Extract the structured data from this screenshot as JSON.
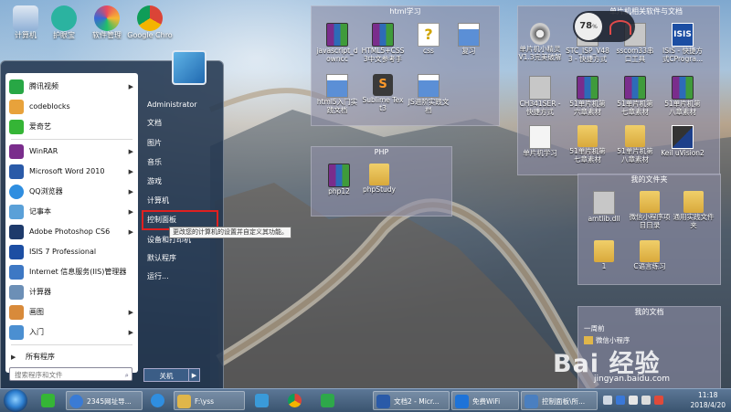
{
  "desktop_icons": [
    {
      "label": "计算机",
      "icon": "computer-icon"
    },
    {
      "label": "护眼宝",
      "icon": "eye-protect-icon"
    },
    {
      "label": "软件管理",
      "icon": "software-manager-icon"
    },
    {
      "label": "Google Chro",
      "icon": "chrome-icon"
    }
  ],
  "speed_widget": {
    "percent": "78",
    "unit": "%"
  },
  "panels": {
    "html": {
      "title": "html学习",
      "items": [
        {
          "label": "javascript_d owncc",
          "icon": "rar"
        },
        {
          "label": "HTML5+CSS 3中文参考手",
          "icon": "rar"
        },
        {
          "label": "css",
          "icon": "q"
        },
        {
          "label": "复习",
          "icon": "blue"
        },
        {
          "label": "html5入门实 践文档",
          "icon": "blue"
        },
        {
          "label": "Sublime Tex t3",
          "icon": "subl"
        },
        {
          "label": "JS进阶实践文 档",
          "icon": "blue"
        }
      ]
    },
    "mcu": {
      "title": "单片机相关软件与文档",
      "items": [
        {
          "label": "单片机小精灵 V1.3完美破解",
          "icon": "gear"
        },
        {
          "label": "STC_ISP_V48 3 - 快捷方式",
          "icon": "exe"
        },
        {
          "label": "sscom33串 口工具",
          "icon": "exe"
        },
        {
          "label": "ISIS - 快捷方 式CProgra...",
          "icon": "isis"
        },
        {
          "label": "CH341SER - 快捷方式",
          "icon": "exe"
        },
        {
          "label": "51单片机第 六章素材",
          "icon": "rar"
        },
        {
          "label": "51单片机第 七章素材",
          "icon": "rar"
        },
        {
          "label": "51单片机第 八章素材",
          "icon": "rar"
        },
        {
          "label": "单片机学习",
          "icon": "doc"
        },
        {
          "label": "51单片机第 七章素材",
          "icon": "folder"
        },
        {
          "label": "51单片机第 八章素材",
          "icon": "folder"
        },
        {
          "label": "Keil uVision2",
          "icon": "keil"
        }
      ]
    },
    "php": {
      "title": "PHP",
      "items": [
        {
          "label": "php12",
          "icon": "rar"
        },
        {
          "label": "phpStudy",
          "icon": "folder"
        }
      ]
    },
    "myfolder": {
      "title": "我的文件夹",
      "items": [
        {
          "label": "amtlib.dll",
          "icon": "exe"
        },
        {
          "label": "微信小程序项 目目录",
          "icon": "folder"
        },
        {
          "label": "通用实践文件 夹",
          "icon": "folder"
        },
        {
          "label": "1",
          "icon": "folder"
        },
        {
          "label": "C语言练习",
          "icon": "folder"
        }
      ]
    },
    "mydocs": {
      "title": "我的文档",
      "sub": "一周前",
      "items": [
        {
          "label": "微信小程序",
          "icon": "folder"
        }
      ]
    }
  },
  "start_menu": {
    "programs": [
      {
        "label": "腾讯视频",
        "icon": "tencent-video-icon",
        "color": "#28a745",
        "arrow": true
      },
      {
        "label": "codeblocks",
        "icon": "codeblocks-icon",
        "color": "#e8a23b",
        "arrow": false
      },
      {
        "label": "爱奇艺",
        "icon": "iqiyi-icon",
        "color": "#35b536",
        "arrow": false
      },
      {
        "label": "WinRAR",
        "icon": "winrar-icon",
        "color": "#7a2d8c",
        "arrow": true
      },
      {
        "label": "Microsoft Word 2010",
        "icon": "word-icon",
        "color": "#2a5aa8",
        "arrow": true
      },
      {
        "label": "QQ浏览器",
        "icon": "qq-browser-icon",
        "color": "#2f8ee0",
        "arrow": true
      },
      {
        "label": "记事本",
        "icon": "notepad-icon",
        "color": "#5aa0d8",
        "arrow": true
      },
      {
        "label": "Adobe Photoshop CS6",
        "icon": "photoshop-icon",
        "color": "#1d3a6b",
        "arrow": true
      },
      {
        "label": "ISIS 7 Professional",
        "icon": "isis-icon",
        "color": "#1c4ea3",
        "arrow": false
      },
      {
        "label": "Internet 信息服务(IIS)管理器",
        "icon": "iis-icon",
        "color": "#3d78c4",
        "arrow": false
      },
      {
        "label": "计算器",
        "icon": "calculator-icon",
        "color": "#6c8fb6",
        "arrow": false
      },
      {
        "label": "画图",
        "icon": "paint-icon",
        "color": "#d88a3a",
        "arrow": true
      },
      {
        "label": "入门",
        "icon": "getting-started-icon",
        "color": "#4b8fd1",
        "arrow": true
      }
    ],
    "all_programs": "所有程序",
    "search_placeholder": "搜索程序和文件",
    "right_items": [
      "Administrator",
      "文档",
      "图片",
      "音乐",
      "游戏",
      "计算机",
      "控制面板",
      "设备和打印机",
      "默认程序",
      "运行..."
    ],
    "tooltip": "更改您的计算机的设置并自定义其功能。",
    "shutdown": "关机"
  },
  "taskbar": {
    "items": [
      {
        "label": "",
        "icon": "iqiyi-icon",
        "color": "#35b536"
      },
      {
        "label": "2345网址导...",
        "icon": "browser-2345-icon",
        "color": "#3a7bd5"
      },
      {
        "label": "",
        "icon": "ie-icon",
        "color": "#2f8ee0"
      },
      {
        "label": "F:\\yss",
        "icon": "folder-icon",
        "color": "#e0b64a"
      },
      {
        "label": "",
        "icon": "boat-icon",
        "color": "#3a9ad9"
      },
      {
        "label": "",
        "icon": "chrome-icon",
        "color": "#e04a3a"
      },
      {
        "label": "",
        "icon": "play-icon",
        "color": "#2ea84a"
      },
      {
        "label": "文档2 - Micr...",
        "icon": "word-icon",
        "color": "#2a5aa8"
      },
      {
        "label": "免费WiFi",
        "icon": "wifi-shield-icon",
        "color": "#1e73d8"
      },
      {
        "label": "控制面板\\所...",
        "icon": "control-panel-icon",
        "color": "#4a7fc0"
      }
    ],
    "clock_time": "11:18",
    "clock_date": "2018/4/20"
  },
  "watermark": {
    "brand": "Bai 经验",
    "url": "jingyan.baidu.com"
  }
}
